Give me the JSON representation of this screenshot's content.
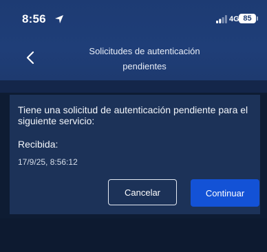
{
  "status_bar": {
    "time": "8:56",
    "network": "4G",
    "battery": "85"
  },
  "nav": {
    "title_line1": "Solicitudes de autenticación",
    "title_line2": "pendientes"
  },
  "card": {
    "message": "Tiene una solicitud de autenticación pendiente para el siguiente servicio:",
    "received_label": "Recibida:",
    "received_value": "17/9/25, 8:56:12",
    "cancel_label": "Cancelar",
    "continue_label": "Continuar"
  },
  "colors": {
    "header": "#1d3b73",
    "card": "#1c3258",
    "primary_button": "#1352d6",
    "background": "#0e1c33"
  },
  "icons": {
    "back": "chevron-left-icon",
    "location": "location-arrow-icon",
    "signal": "cellular-signal-icon"
  }
}
